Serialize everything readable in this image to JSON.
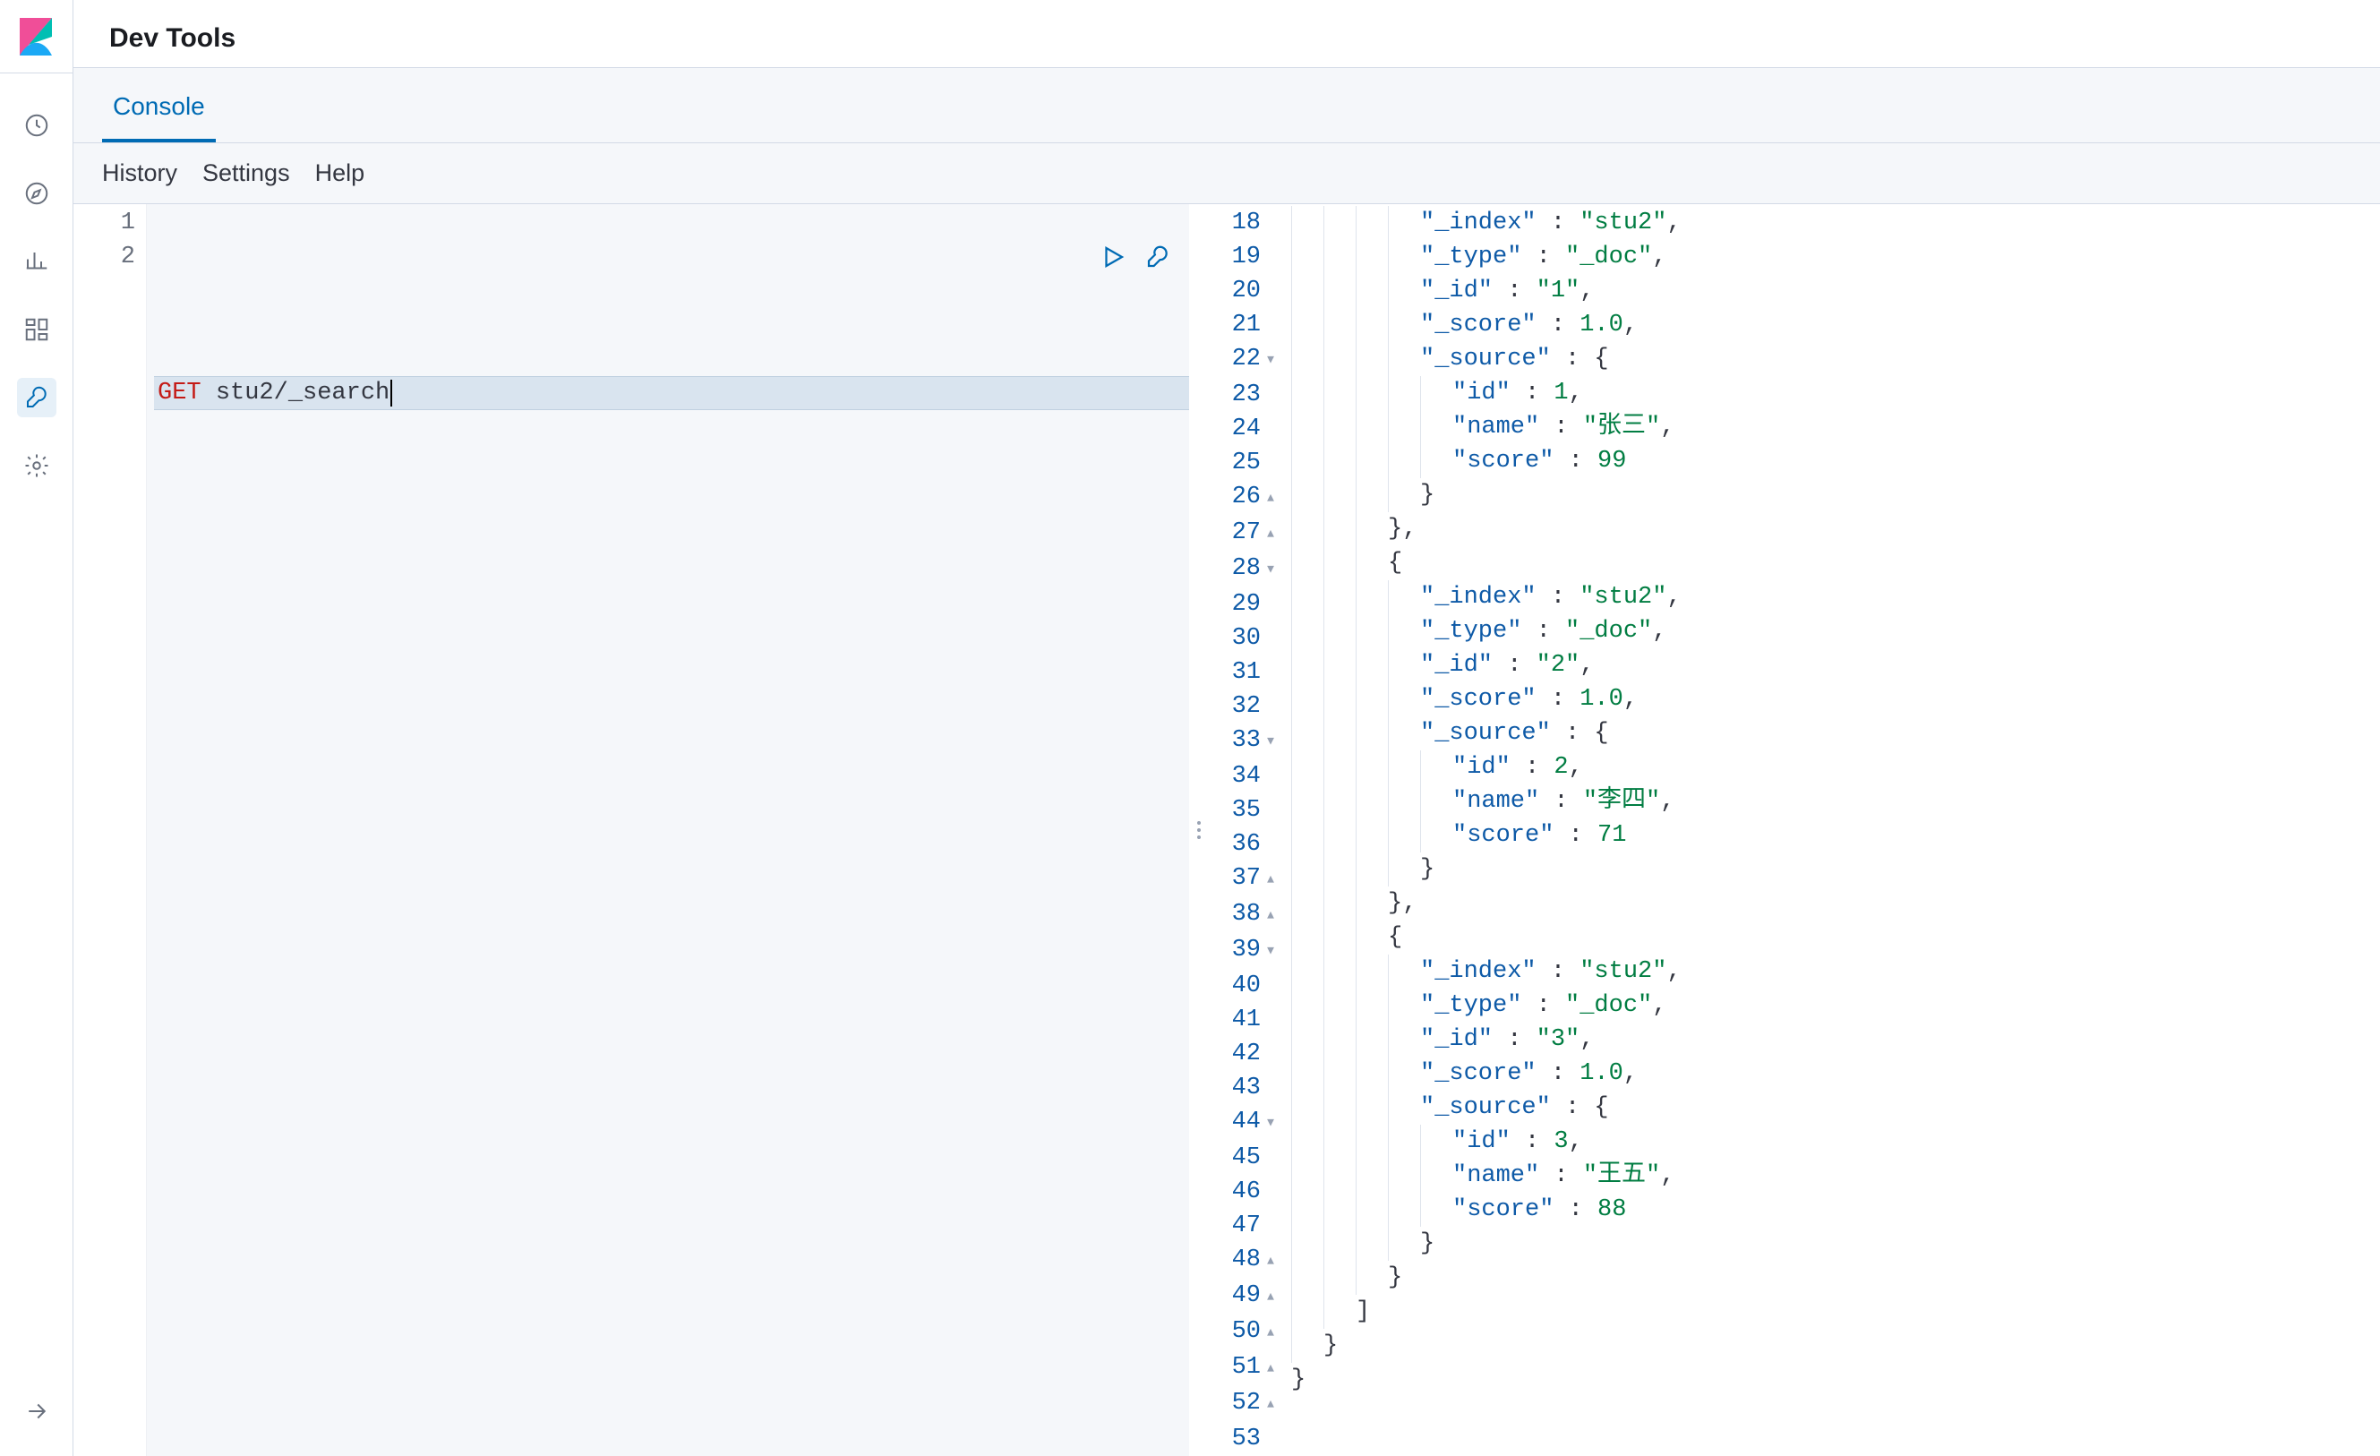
{
  "header": {
    "title": "Dev Tools"
  },
  "tabs": {
    "console": "Console"
  },
  "subtabs": {
    "history": "History",
    "settings": "Settings",
    "help": "Help"
  },
  "editor": {
    "lines": [
      "1",
      "2"
    ],
    "method": "GET",
    "path": "stu2/_search"
  },
  "output_gutter": [
    {
      "n": "18",
      "f": ""
    },
    {
      "n": "19",
      "f": ""
    },
    {
      "n": "20",
      "f": ""
    },
    {
      "n": "21",
      "f": ""
    },
    {
      "n": "22",
      "f": "▾"
    },
    {
      "n": "23",
      "f": ""
    },
    {
      "n": "24",
      "f": ""
    },
    {
      "n": "25",
      "f": ""
    },
    {
      "n": "26",
      "f": "▴"
    },
    {
      "n": "27",
      "f": "▴"
    },
    {
      "n": "28",
      "f": "▾"
    },
    {
      "n": "29",
      "f": ""
    },
    {
      "n": "30",
      "f": ""
    },
    {
      "n": "31",
      "f": ""
    },
    {
      "n": "32",
      "f": ""
    },
    {
      "n": "33",
      "f": "▾"
    },
    {
      "n": "34",
      "f": ""
    },
    {
      "n": "35",
      "f": ""
    },
    {
      "n": "36",
      "f": ""
    },
    {
      "n": "37",
      "f": "▴"
    },
    {
      "n": "38",
      "f": "▴"
    },
    {
      "n": "39",
      "f": "▾"
    },
    {
      "n": "40",
      "f": ""
    },
    {
      "n": "41",
      "f": ""
    },
    {
      "n": "42",
      "f": ""
    },
    {
      "n": "43",
      "f": ""
    },
    {
      "n": "44",
      "f": "▾"
    },
    {
      "n": "45",
      "f": ""
    },
    {
      "n": "46",
      "f": ""
    },
    {
      "n": "47",
      "f": ""
    },
    {
      "n": "48",
      "f": "▴"
    },
    {
      "n": "49",
      "f": "▴"
    },
    {
      "n": "50",
      "f": "▴"
    },
    {
      "n": "51",
      "f": "▴"
    },
    {
      "n": "52",
      "f": "▴"
    },
    {
      "n": "53",
      "f": ""
    }
  ],
  "output_lines": [
    {
      "indent": 4,
      "tokens": [
        {
          "t": "key",
          "v": "\"_index\""
        },
        {
          "t": "brace",
          "v": " : "
        },
        {
          "t": "str",
          "v": "\"stu2\""
        },
        {
          "t": "brace",
          "v": ","
        }
      ]
    },
    {
      "indent": 4,
      "tokens": [
        {
          "t": "key",
          "v": "\"_type\""
        },
        {
          "t": "brace",
          "v": " : "
        },
        {
          "t": "str",
          "v": "\"_doc\""
        },
        {
          "t": "brace",
          "v": ","
        }
      ]
    },
    {
      "indent": 4,
      "tokens": [
        {
          "t": "key",
          "v": "\"_id\""
        },
        {
          "t": "brace",
          "v": " : "
        },
        {
          "t": "str",
          "v": "\"1\""
        },
        {
          "t": "brace",
          "v": ","
        }
      ]
    },
    {
      "indent": 4,
      "tokens": [
        {
          "t": "key",
          "v": "\"_score\""
        },
        {
          "t": "brace",
          "v": " : "
        },
        {
          "t": "numval",
          "v": "1.0"
        },
        {
          "t": "brace",
          "v": ","
        }
      ]
    },
    {
      "indent": 4,
      "tokens": [
        {
          "t": "key",
          "v": "\"_source\""
        },
        {
          "t": "brace",
          "v": " : {"
        }
      ]
    },
    {
      "indent": 5,
      "tokens": [
        {
          "t": "key",
          "v": "\"id\""
        },
        {
          "t": "brace",
          "v": " : "
        },
        {
          "t": "numval",
          "v": "1"
        },
        {
          "t": "brace",
          "v": ","
        }
      ]
    },
    {
      "indent": 5,
      "tokens": [
        {
          "t": "key",
          "v": "\"name\""
        },
        {
          "t": "brace",
          "v": " : "
        },
        {
          "t": "str",
          "v": "\"张三\""
        },
        {
          "t": "brace",
          "v": ","
        }
      ]
    },
    {
      "indent": 5,
      "tokens": [
        {
          "t": "key",
          "v": "\"score\""
        },
        {
          "t": "brace",
          "v": " : "
        },
        {
          "t": "numval",
          "v": "99"
        }
      ]
    },
    {
      "indent": 4,
      "tokens": [
        {
          "t": "brace",
          "v": "}"
        }
      ]
    },
    {
      "indent": 3,
      "tokens": [
        {
          "t": "brace",
          "v": "},"
        }
      ]
    },
    {
      "indent": 3,
      "tokens": [
        {
          "t": "brace",
          "v": "{"
        }
      ]
    },
    {
      "indent": 4,
      "tokens": [
        {
          "t": "key",
          "v": "\"_index\""
        },
        {
          "t": "brace",
          "v": " : "
        },
        {
          "t": "str",
          "v": "\"stu2\""
        },
        {
          "t": "brace",
          "v": ","
        }
      ]
    },
    {
      "indent": 4,
      "tokens": [
        {
          "t": "key",
          "v": "\"_type\""
        },
        {
          "t": "brace",
          "v": " : "
        },
        {
          "t": "str",
          "v": "\"_doc\""
        },
        {
          "t": "brace",
          "v": ","
        }
      ]
    },
    {
      "indent": 4,
      "tokens": [
        {
          "t": "key",
          "v": "\"_id\""
        },
        {
          "t": "brace",
          "v": " : "
        },
        {
          "t": "str",
          "v": "\"2\""
        },
        {
          "t": "brace",
          "v": ","
        }
      ]
    },
    {
      "indent": 4,
      "tokens": [
        {
          "t": "key",
          "v": "\"_score\""
        },
        {
          "t": "brace",
          "v": " : "
        },
        {
          "t": "numval",
          "v": "1.0"
        },
        {
          "t": "brace",
          "v": ","
        }
      ]
    },
    {
      "indent": 4,
      "tokens": [
        {
          "t": "key",
          "v": "\"_source\""
        },
        {
          "t": "brace",
          "v": " : {"
        }
      ]
    },
    {
      "indent": 5,
      "tokens": [
        {
          "t": "key",
          "v": "\"id\""
        },
        {
          "t": "brace",
          "v": " : "
        },
        {
          "t": "numval",
          "v": "2"
        },
        {
          "t": "brace",
          "v": ","
        }
      ]
    },
    {
      "indent": 5,
      "tokens": [
        {
          "t": "key",
          "v": "\"name\""
        },
        {
          "t": "brace",
          "v": " : "
        },
        {
          "t": "str",
          "v": "\"李四\""
        },
        {
          "t": "brace",
          "v": ","
        }
      ]
    },
    {
      "indent": 5,
      "tokens": [
        {
          "t": "key",
          "v": "\"score\""
        },
        {
          "t": "brace",
          "v": " : "
        },
        {
          "t": "numval",
          "v": "71"
        }
      ]
    },
    {
      "indent": 4,
      "tokens": [
        {
          "t": "brace",
          "v": "}"
        }
      ]
    },
    {
      "indent": 3,
      "tokens": [
        {
          "t": "brace",
          "v": "},"
        }
      ]
    },
    {
      "indent": 3,
      "tokens": [
        {
          "t": "brace",
          "v": "{"
        }
      ]
    },
    {
      "indent": 4,
      "tokens": [
        {
          "t": "key",
          "v": "\"_index\""
        },
        {
          "t": "brace",
          "v": " : "
        },
        {
          "t": "str",
          "v": "\"stu2\""
        },
        {
          "t": "brace",
          "v": ","
        }
      ]
    },
    {
      "indent": 4,
      "tokens": [
        {
          "t": "key",
          "v": "\"_type\""
        },
        {
          "t": "brace",
          "v": " : "
        },
        {
          "t": "str",
          "v": "\"_doc\""
        },
        {
          "t": "brace",
          "v": ","
        }
      ]
    },
    {
      "indent": 4,
      "tokens": [
        {
          "t": "key",
          "v": "\"_id\""
        },
        {
          "t": "brace",
          "v": " : "
        },
        {
          "t": "str",
          "v": "\"3\""
        },
        {
          "t": "brace",
          "v": ","
        }
      ]
    },
    {
      "indent": 4,
      "tokens": [
        {
          "t": "key",
          "v": "\"_score\""
        },
        {
          "t": "brace",
          "v": " : "
        },
        {
          "t": "numval",
          "v": "1.0"
        },
        {
          "t": "brace",
          "v": ","
        }
      ]
    },
    {
      "indent": 4,
      "tokens": [
        {
          "t": "key",
          "v": "\"_source\""
        },
        {
          "t": "brace",
          "v": " : {"
        }
      ]
    },
    {
      "indent": 5,
      "tokens": [
        {
          "t": "key",
          "v": "\"id\""
        },
        {
          "t": "brace",
          "v": " : "
        },
        {
          "t": "numval",
          "v": "3"
        },
        {
          "t": "brace",
          "v": ","
        }
      ]
    },
    {
      "indent": 5,
      "tokens": [
        {
          "t": "key",
          "v": "\"name\""
        },
        {
          "t": "brace",
          "v": " : "
        },
        {
          "t": "str",
          "v": "\"王五\""
        },
        {
          "t": "brace",
          "v": ","
        }
      ]
    },
    {
      "indent": 5,
      "tokens": [
        {
          "t": "key",
          "v": "\"score\""
        },
        {
          "t": "brace",
          "v": " : "
        },
        {
          "t": "numval",
          "v": "88"
        }
      ]
    },
    {
      "indent": 4,
      "tokens": [
        {
          "t": "brace",
          "v": "}"
        }
      ]
    },
    {
      "indent": 3,
      "tokens": [
        {
          "t": "brace",
          "v": "}"
        }
      ]
    },
    {
      "indent": 2,
      "tokens": [
        {
          "t": "brace",
          "v": "]"
        }
      ]
    },
    {
      "indent": 1,
      "tokens": [
        {
          "t": "brace",
          "v": "}"
        }
      ]
    },
    {
      "indent": 0,
      "tokens": [
        {
          "t": "brace",
          "v": "}"
        }
      ]
    },
    {
      "indent": 0,
      "tokens": []
    }
  ]
}
